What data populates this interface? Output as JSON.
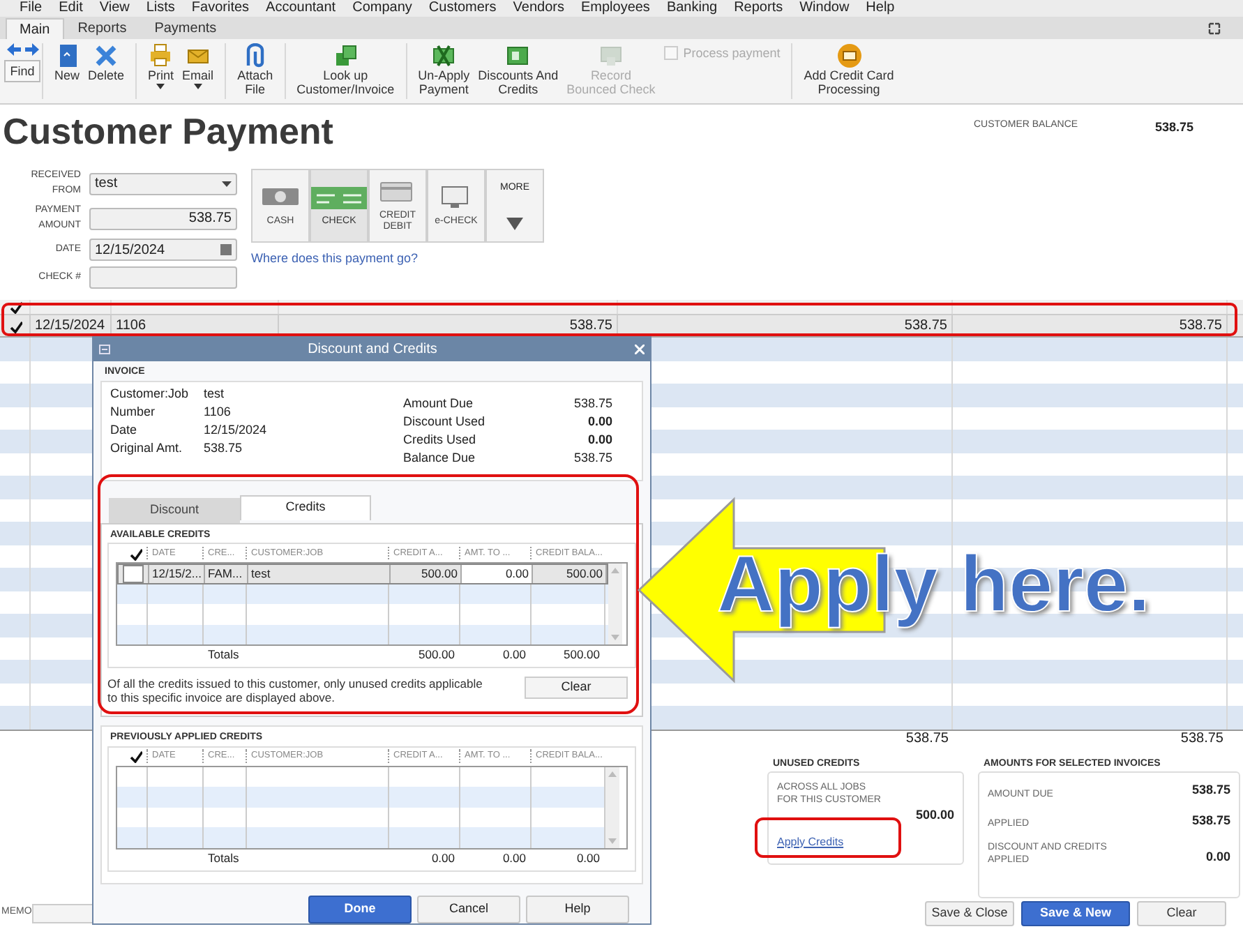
{
  "menu_bar": [
    "File",
    "Edit",
    "View",
    "Lists",
    "Favorites",
    "Accountant",
    "Company",
    "Customers",
    "Vendors",
    "Employees",
    "Banking",
    "Reports",
    "Window",
    "Help"
  ],
  "ribbon_tabs": [
    {
      "label": "Main",
      "selected": true
    },
    {
      "label": "Reports",
      "selected": false
    },
    {
      "label": "Payments",
      "selected": false
    }
  ],
  "toolbar": {
    "find": "Find",
    "groups": [
      [
        {
          "kind": "button",
          "label": "New"
        },
        {
          "kind": "button",
          "label": "Delete"
        }
      ],
      [
        {
          "kind": "button",
          "label": "Print",
          "dropdown": true
        },
        {
          "kind": "button",
          "label": "Email",
          "dropdown": true
        }
      ],
      [
        {
          "kind": "button",
          "label": "Attach\nFile"
        }
      ],
      [
        {
          "kind": "button",
          "label": "Look up\nCustomer/Invoice"
        }
      ],
      [
        {
          "kind": "button",
          "label": "Un-Apply\nPayment"
        },
        {
          "kind": "button",
          "label": "Discounts And\nCredits"
        },
        {
          "kind": "button",
          "label": "Record\nBounced Check",
          "disabled": true
        },
        {
          "kind": "checkbox",
          "label": "Process payment",
          "checked": false,
          "disabled": true
        }
      ],
      [
        {
          "kind": "button",
          "label": "Add Credit Card\nProcessing"
        }
      ]
    ]
  },
  "title": "Customer Payment",
  "customer_balance": {
    "label": "CUSTOMER BALANCE",
    "value": "538.75"
  },
  "fields": [
    {
      "kind": "dropdown",
      "label": "RECEIVED FROM",
      "value": "test"
    },
    {
      "kind": "amount",
      "label": "PAYMENT AMOUNT",
      "value": "538.75"
    },
    {
      "kind": "date",
      "label": "DATE",
      "value": "12/15/2024"
    },
    {
      "kind": "text",
      "label": "CHECK #"
    }
  ],
  "payment_methods": [
    {
      "label": "CASH",
      "selected": false
    },
    {
      "label": "CHECK",
      "selected": true
    },
    {
      "label": "CREDIT\nDEBIT",
      "selected": false
    },
    {
      "label": "e-CHECK",
      "selected": false
    }
  ],
  "more_button": "MORE",
  "help_link": "Where does this payment go?",
  "invoices": {
    "rows": [
      {
        "checked": true,
        "selected": true,
        "cells": [
          "12/15/2024",
          "1106",
          "538.75",
          "538.75",
          "538.75"
        ]
      }
    ],
    "totals": [
      "538.75",
      "538.75"
    ]
  },
  "unused_credits": {
    "title": "UNUSED CREDITS",
    "label": "ACROSS ALL JOBS\nFOR THIS CUSTOMER",
    "value": "500.00",
    "link": "Apply Credits"
  },
  "amounts": {
    "title": "AMOUNTS FOR SELECTED INVOICES",
    "rows": [
      {
        "label": "AMOUNT DUE",
        "value": "538.75"
      },
      {
        "label": "APPLIED",
        "value": "538.75"
      },
      {
        "label": "DISCOUNT AND CREDITS\nAPPLIED",
        "value": "0.00"
      }
    ]
  },
  "memo": {
    "label": "MEMO"
  },
  "actions": [
    {
      "label": "Save & Close",
      "primary": false
    },
    {
      "label": "Save & New",
      "primary": true
    },
    {
      "label": "Clear",
      "primary": false
    }
  ],
  "dialog": {
    "title": "Discount and Credits",
    "invoice": {
      "heading": "INVOICE",
      "left": [
        {
          "label": "Customer:Job",
          "value": "test"
        },
        {
          "label": "Number",
          "value": "1106"
        },
        {
          "label": "Date",
          "value": "12/15/2024"
        },
        {
          "label": "Original Amt.",
          "value": "538.75"
        }
      ],
      "right": [
        {
          "label": "Amount Due",
          "value": "538.75",
          "bold": false
        },
        {
          "label": "Discount Used",
          "value": "0.00",
          "bold": true
        },
        {
          "label": "Credits Used",
          "value": "0.00",
          "bold": true
        },
        {
          "label": "Balance Due",
          "value": "538.75",
          "bold": false
        }
      ]
    },
    "tabs": [
      {
        "label": "Discount",
        "selected": false
      },
      {
        "label": "Credits",
        "selected": true
      }
    ],
    "available": {
      "heading": "AVAILABLE CREDITS",
      "columns": [
        "DATE",
        "CRE...",
        "CUSTOMER:JOB",
        "CREDIT A...",
        "AMT. TO ...",
        "CREDIT BALA..."
      ],
      "rows": [
        {
          "checked": false,
          "cells": [
            "12/15/2...",
            "FAM...",
            "test",
            "500.00",
            "0.00",
            "500.00"
          ]
        }
      ],
      "totals_label": "Totals",
      "totals": [
        "500.00",
        "0.00",
        "500.00"
      ]
    },
    "note": "Of all the credits issued to this customer, only unused credits applicable to this specific invoice are displayed above.",
    "clear": "Clear",
    "previous": {
      "heading": "PREVIOUSLY APPLIED CREDITS",
      "columns": [
        "DATE",
        "CRE...",
        "CUSTOMER:JOB",
        "CREDIT A...",
        "AMT. TO ...",
        "CREDIT BALA..."
      ],
      "totals_label": "Totals",
      "totals": [
        "0.00",
        "0.00",
        "0.00"
      ]
    },
    "buttons": [
      {
        "label": "Done",
        "primary": true
      },
      {
        "label": "Cancel",
        "primary": false
      },
      {
        "label": "Help",
        "primary": false
      }
    ]
  },
  "callout": "Apply here."
}
